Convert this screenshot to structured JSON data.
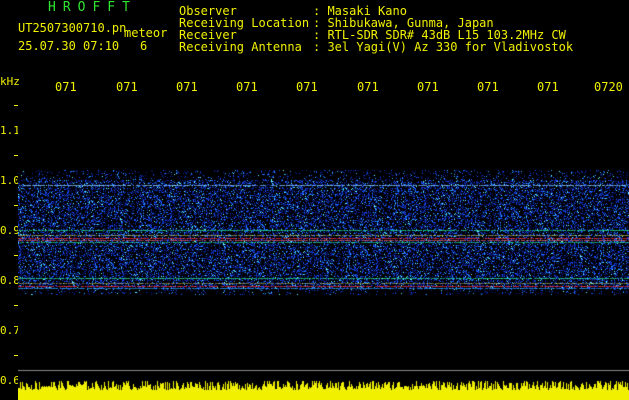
{
  "left_header": {
    "brand": "HROFFT",
    "filename": "UT2507300710.pn",
    "mode": "meteor",
    "datetime": "25.07.30 07:10",
    "counter": "6"
  },
  "station_info": [
    {
      "label": "Observer",
      "value": ": Masaki Kano"
    },
    {
      "label": "Receiving Location",
      "value": ": Shibukawa, Gunma, Japan"
    },
    {
      "label": "Receiver",
      "value": ": RTL-SDR SDR# 43dB L15 103.2MHz CW"
    },
    {
      "label": "Receiving Antenna",
      "value": ": 3el Yagi(V) Az 330 for Vladivostok"
    }
  ],
  "y_axis": {
    "unit": "kHz",
    "ticks": [
      "1.1",
      "1.0",
      "0.9",
      "0.8",
      "0.7",
      "0.6"
    ]
  },
  "x_axis": {
    "ticks": [
      "071",
      "071",
      "071",
      "071",
      "071",
      "071",
      "071",
      "071",
      "071",
      "0720"
    ]
  },
  "colors": {
    "text_yellow": "#f0f000",
    "brand_green": "#2ee62e",
    "signal_blue": "#1a4dff",
    "signal_red": "#ff2020",
    "amplitude_yellow": "#f0f000"
  }
}
